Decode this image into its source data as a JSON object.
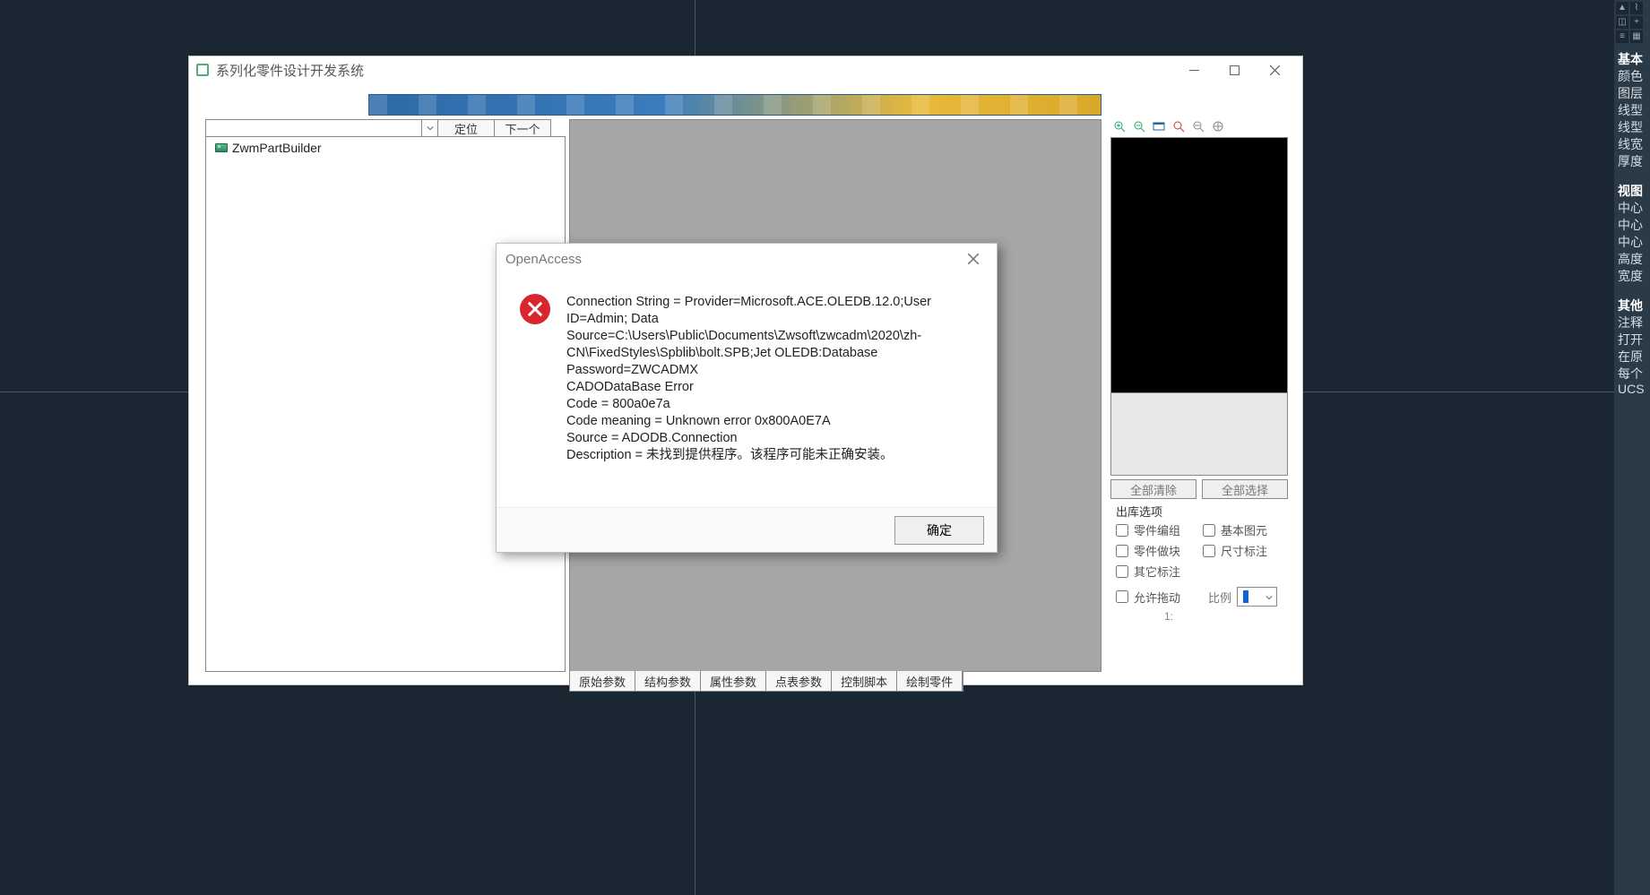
{
  "app": {
    "title": "系列化零件设计开发系统",
    "toolbar": {
      "locate": "定位",
      "next": "下一个"
    },
    "tree": {
      "root": "ZwmPartBuilder"
    },
    "tabs": [
      "原始参数",
      "结构参数",
      "属性参数",
      "点表参数",
      "控制脚本",
      "绘制零件"
    ],
    "selectButtons": {
      "clear": "全部清除",
      "all": "全部选择"
    },
    "optsTitle": "出库选项",
    "opts": {
      "group": "零件编组",
      "prim": "基本图元",
      "block": "零件做块",
      "dim": "尺寸标注",
      "other": "其它标注",
      "drag": "允许拖动"
    },
    "ratioLabel": "比例",
    "ratioValue": "1:"
  },
  "dialog": {
    "title": "OpenAccess",
    "text": "Connection String = Provider=Microsoft.ACE.OLEDB.12.0;User ID=Admin; Data Source=C:\\Users\\Public\\Documents\\Zwsoft\\zwcadm\\2020\\zh-CN\\FixedStyles\\Spblib\\bolt.SPB;Jet OLEDB:Database Password=ZWCADMX\nCADODataBase Error\n                Code = 800a0e7a\n                Code meaning = Unknown error 0x800A0E7A\n                Source = ADODB.Connection\n                Description = 未找到提供程序。该程序可能未正确安装。",
    "ok": "确定"
  },
  "sidebar": {
    "items": [
      "基本",
      "颜色",
      "图层",
      "线型",
      "线型",
      "线宽",
      "厚度",
      "",
      "视图",
      "中心",
      "中心",
      "中心",
      "高度",
      "宽度",
      "",
      "其他",
      "注释",
      "打开",
      "在原",
      "每个",
      "UCS"
    ]
  }
}
